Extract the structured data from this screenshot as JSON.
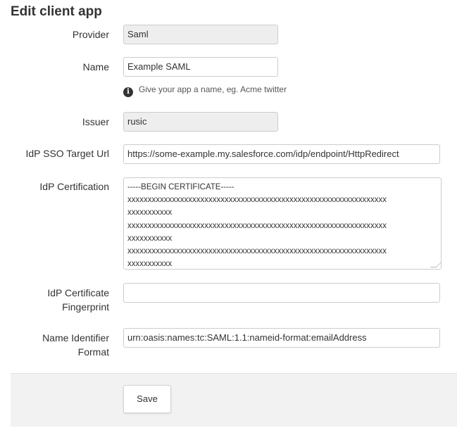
{
  "page": {
    "title": "Edit client app"
  },
  "form": {
    "provider": {
      "label": "Provider",
      "value": "Saml"
    },
    "name": {
      "label": "Name",
      "value": "Example SAML",
      "hint": "Give your app a name, eg. Acme twitter"
    },
    "issuer": {
      "label": "Issuer",
      "value": "rusic"
    },
    "idp_sso_target_url": {
      "label": "IdP SSO Target Url",
      "value": "https://some-example.my.salesforce.com/idp/endpoint/HttpRedirect"
    },
    "idp_certification": {
      "label": "IdP Certification",
      "lines": [
        "-----BEGIN CERTIFICATE-----",
        "xxxxxxxxxxxxxxxxxxxxxxxxxxxxxxxxxxxxxxxxxxxxxxxxxxxxxxxxxxxxxxxx",
        "xxxxxxxxxxx",
        "xxxxxxxxxxxxxxxxxxxxxxxxxxxxxxxxxxxxxxxxxxxxxxxxxxxxxxxxxxxxxxxx",
        "xxxxxxxxxxx",
        "xxxxxxxxxxxxxxxxxxxxxxxxxxxxxxxxxxxxxxxxxxxxxxxxxxxxxxxxxxxxxxxx",
        "xxxxxxxxxxx"
      ]
    },
    "idp_cert_fingerprint": {
      "label_line1": "IdP Certificate",
      "label_line2": "Fingerprint",
      "value": ""
    },
    "name_identifier_format": {
      "label_line1": "Name Identifier",
      "label_line2": "Format",
      "value": "urn:oasis:names:tc:SAML:1.1:nameid-format:emailAddress"
    }
  },
  "actions": {
    "save_label": "Save"
  },
  "icons": {
    "hint_icon": "info-icon"
  }
}
